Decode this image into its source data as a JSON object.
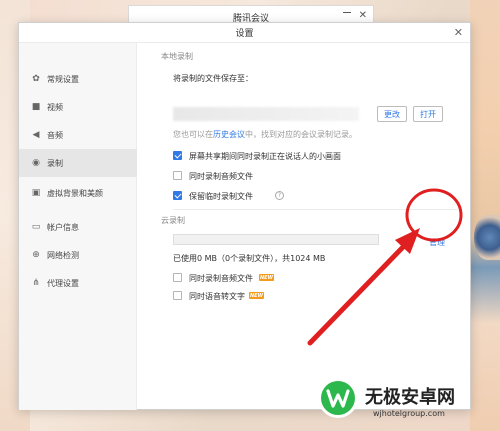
{
  "back_window": {
    "title": "腾讯会议"
  },
  "dialog": {
    "title": "设置"
  },
  "sidebar": {
    "items": [
      {
        "label": "常规设置",
        "icon": "gear-icon"
      },
      {
        "label": "视频",
        "icon": "video-icon"
      },
      {
        "label": "音频",
        "icon": "speaker-icon"
      },
      {
        "label": "录制",
        "icon": "record-icon",
        "active": true
      },
      {
        "label": "虚拟背景和美颜",
        "icon": "portrait-icon"
      },
      {
        "label": "帐户信息",
        "icon": "account-icon"
      },
      {
        "label": "网络检测",
        "icon": "network-icon"
      },
      {
        "label": "代理设置",
        "icon": "proxy-icon"
      }
    ]
  },
  "local_recording": {
    "section_label": "本地录制",
    "save_label": "将录制的文件保存至：",
    "change_button": "更改",
    "open_button": "打开",
    "hint_prefix": "您也可以在",
    "hint_link": "历史会议",
    "hint_suffix": "中，找到对应的会议录制记录。",
    "options": [
      {
        "label": "屏幕共享期间同时录制正在说话人的小画面",
        "checked": true
      },
      {
        "label": "同时录制音频文件",
        "checked": false
      },
      {
        "label": "保留临时录制文件",
        "checked": true,
        "help": "?"
      }
    ]
  },
  "cloud_recording": {
    "section_label": "云录制",
    "manage_button": "管理",
    "usage_text": "已使用0 MB（0个录制文件），共1024 MB",
    "usage_fraction": 0,
    "options": [
      {
        "label": "同时录制音频文件",
        "checked": false,
        "badge": "NEW"
      },
      {
        "label": "同时语音转文字",
        "checked": false,
        "badge": "NEW"
      }
    ]
  },
  "watermark": {
    "title": "无极安卓网",
    "url": "wjhotelgroup.com"
  },
  "colors": {
    "accent": "#2f7ae5",
    "annotation": "#e02020",
    "badge": "#f39b1d"
  }
}
